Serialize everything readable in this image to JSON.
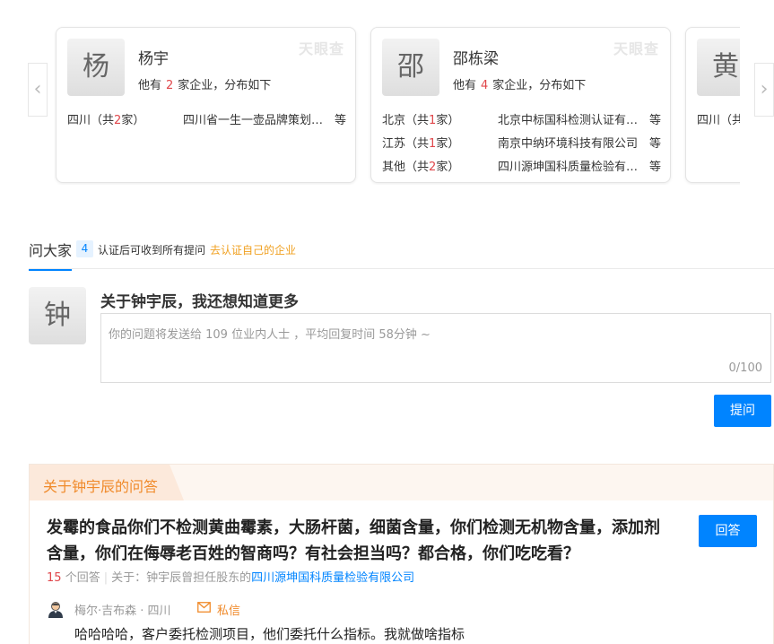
{
  "carousel": {
    "prev_icon": "chevron-left-icon",
    "next_icon": "chevron-right-icon",
    "cards": [
      {
        "avatar_char": "杨",
        "name": "杨宇",
        "watermark": "天眼查",
        "summary_pre": "他有",
        "summary_num": "2",
        "summary_post": "家企业，分布如下",
        "rows": [
          {
            "region": "四川",
            "count": "2",
            "company": "四川省一生一壶品牌策划有限公司",
            "etc": "等"
          }
        ]
      },
      {
        "avatar_char": "邵",
        "name": "邵栋梁",
        "watermark": "天眼查",
        "summary_pre": "他有",
        "summary_num": "4",
        "summary_post": "家企业，分布如下",
        "rows": [
          {
            "region": "北京",
            "count": "1",
            "company": "北京中标国科检测认证有限公司",
            "etc": "等"
          },
          {
            "region": "江苏",
            "count": "1",
            "company": "南京中纳环境科技有限公司",
            "etc": "等"
          },
          {
            "region": "其他",
            "count": "2",
            "company": "四川源坤国科质量检验有限公司",
            "etc": "等"
          }
        ]
      },
      {
        "avatar_char": "黄",
        "name": "",
        "watermark": "",
        "summary_pre": "",
        "summary_num": "",
        "summary_post": "",
        "rows": [
          {
            "region": "四川",
            "count": "",
            "company": "",
            "etc": ""
          }
        ]
      }
    ]
  },
  "ask": {
    "tab_label": "问大家",
    "badge": "4",
    "note": "认证后可收到所有提问",
    "link": "去认证自己的企业",
    "avatar_char": "钟",
    "title": "关于钟宇辰，我还想知道更多",
    "placeholder": "你的问题将发送给 109 位业内人士 ，平均回复时间 58分钟 ~",
    "counter": "0/100",
    "submit_label": "提问"
  },
  "qa": {
    "header": "关于钟宇辰的问答",
    "question": "发霉的食品你们不检测黄曲霉素，大肠杆菌，细菌含量，你们检测无机物含量，添加剂含量，你们在侮辱老百姓的智商吗？有社会担当吗？都合格，你们吃吃看？",
    "answer_button": "回答",
    "answer_count": "15",
    "answer_count_suffix": "个回答",
    "about_prefix": "关于：钟宇辰曾担任股东的",
    "company_link": "四川源坤国科质量检验有限公司",
    "answerer_name": "梅尔·吉布森 · 四川",
    "message_label": "私信",
    "answer_text": "哈哈哈哈，客户委托检测项目，他们委托什么指标。我就做啥指标"
  },
  "colors": {
    "accent": "#0084ff",
    "highlight_red": "#e0474b",
    "orange": "#f08a2a"
  }
}
